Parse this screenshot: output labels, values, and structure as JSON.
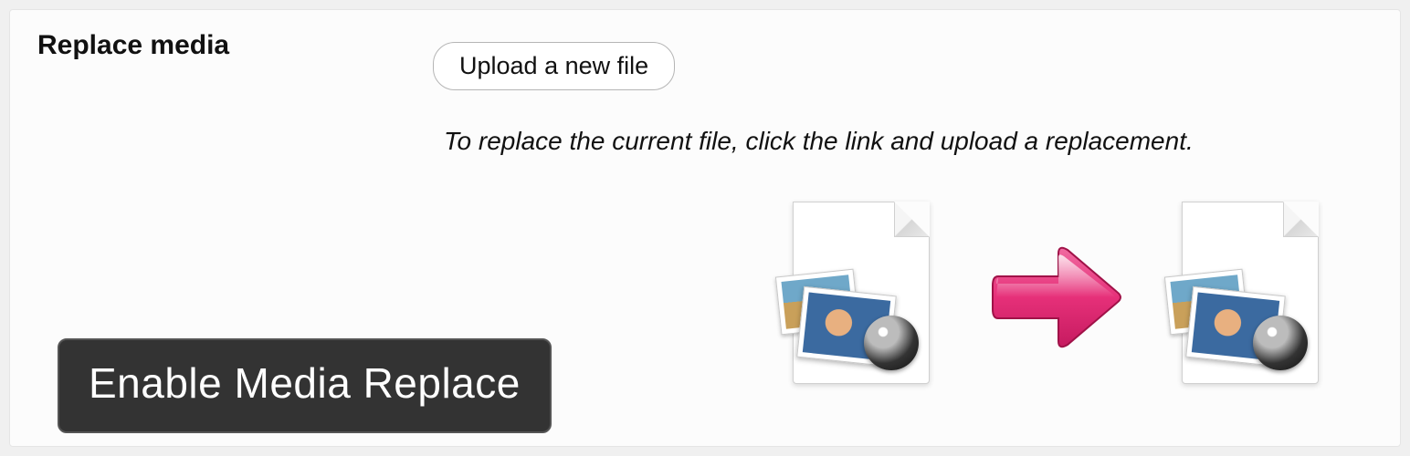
{
  "sectionLabel": "Replace media",
  "uploadButton": "Upload a new file",
  "helpText": "To replace the current file, click the link and upload a replacement.",
  "badgeTitle": "Enable Media Replace",
  "icons": {
    "fileBefore": "image-file-icon",
    "arrow": "arrow-right-icon",
    "fileAfter": "image-file-icon"
  },
  "colors": {
    "arrow": "#e63079",
    "badgeBg": "#333333"
  }
}
